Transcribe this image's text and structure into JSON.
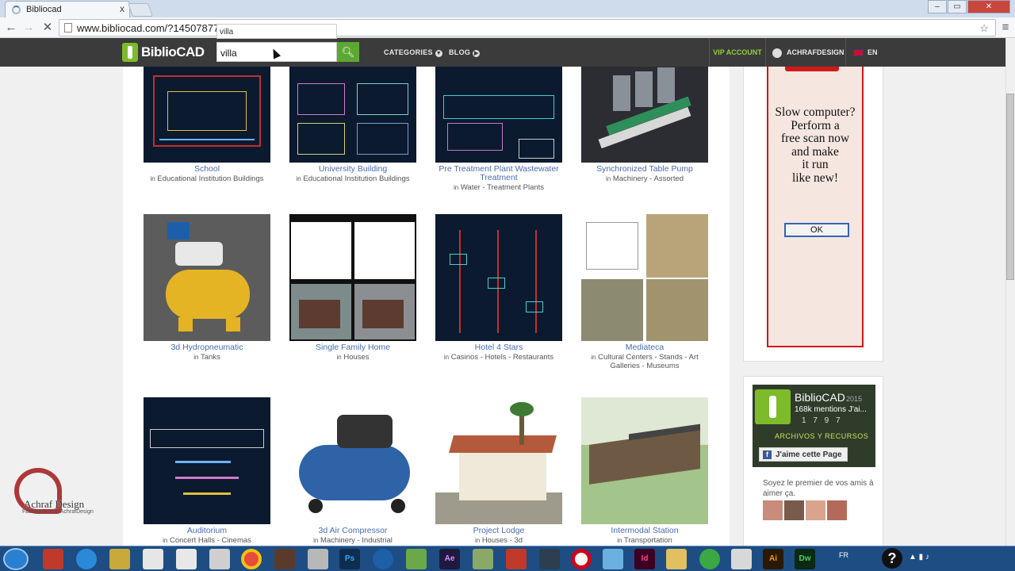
{
  "browser": {
    "tab_title": "Bibliocad",
    "tab_close": "x",
    "url": "www.bibliocad.com/?1450787760"
  },
  "header": {
    "logo_text": "BiblioCAD",
    "search_value": "villa",
    "suggestion": "villa",
    "nav": {
      "categories": "CATEGORIES",
      "blog": "BLOG"
    },
    "vip": "VIP ACCOUNT",
    "account": "ACHRAFDESIGN",
    "language": "EN"
  },
  "cards": [
    {
      "title": "School",
      "category": "Educational Institution Buildings"
    },
    {
      "title": "University Building",
      "category": "Educational Institution Buildings"
    },
    {
      "title": "Pre Treatment Plant Wastewater Treatment",
      "category": "Water - Treatment Plants"
    },
    {
      "title": "Synchronized Table Pump",
      "category": "Machinery - Assorted"
    },
    {
      "title": "3d Hydropneumatic",
      "category": "Tanks"
    },
    {
      "title": "Single Family Home",
      "category": "Houses"
    },
    {
      "title": "Hotel 4 Stars",
      "category": "Casinos - Hotels - Restaurants"
    },
    {
      "title": "Mediateca",
      "category": "Cultural Centers - Stands - Art Galleries - Museums"
    },
    {
      "title": "Auditorium",
      "category": "Concert Halls - Cinemas"
    },
    {
      "title": "3d Air Compressor",
      "category": "Machinery - Industrial"
    },
    {
      "title": "Project Lodge",
      "category": "Houses - 3d"
    },
    {
      "title": "Intermodal Station",
      "category": "Transportation"
    }
  ],
  "in_label": "in",
  "ad": {
    "lines": [
      "Slow computer?",
      "Perform a",
      "free scan now",
      "and make",
      "it run",
      "like new!"
    ],
    "ok": "OK"
  },
  "facebook": {
    "page_name": "BiblioCAD",
    "year": "2015",
    "fans": "168k mentions J'ai...",
    "numbers": "1 7 9 7",
    "subtitle": "ARCHIVOS Y RECURSOS",
    "like_button": "J'aime cette Page",
    "friends_text": "Soyez le premier de vos amis à aimer ça."
  },
  "watermark": {
    "name": "Achraf Design",
    "sub": "Facebook.com/AchrafDesign"
  },
  "taskbar": {
    "locale": "FR",
    "ae": "Ae",
    "ps": "Ps",
    "id": "Id",
    "ai": "Ai",
    "dw": "Dw"
  },
  "colors": {
    "brand_green": "#7dbb2a",
    "link_blue": "#4a6bb5",
    "header_dark": "#3b3b3b",
    "ad_border": "#d01a1a"
  }
}
